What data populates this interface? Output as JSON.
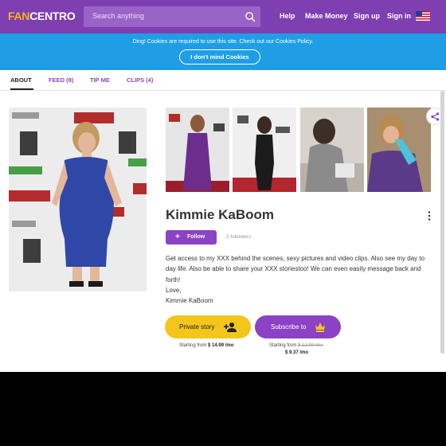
{
  "header": {
    "logo_fan": "FAN",
    "logo_centro": "CENTRO",
    "search_placeholder": "Search anything",
    "nav": [
      "Help",
      "Make Money",
      "Sign up",
      "Sign in"
    ],
    "colors": {
      "header_bg": "#7e3fb1",
      "accent": "#f7b21b"
    }
  },
  "cookie_banner": {
    "text": "Ding! Cookies are required to use this site. Check out our Cookies Policy.",
    "button": "I don't mind Cookies",
    "bg": "#1f9ee6"
  },
  "tabs": [
    {
      "label": "ABOUT",
      "active": true
    },
    {
      "label": "FEED (8)",
      "active": false
    },
    {
      "label": "TIP ME",
      "active": false
    },
    {
      "label": "CLIPS (4)",
      "active": false
    }
  ],
  "profile": {
    "name": "Kimmie KaBoom",
    "follow_label": "Follow",
    "followers": "2 followers",
    "bio": [
      "Get access to my  XXX behind the scenes, sexy pictures and video clips. Also see my day to day life. Also be able to share your XXX storiestoo! We can even easily message back and forth!",
      "Love,",
      "Kimmie KaBoom"
    ]
  },
  "cta": {
    "private": {
      "label": "Private story",
      "starting": "Starting from",
      "price": "$ 14.99 /mo"
    },
    "subscribe": {
      "label": "Subscribe to",
      "starting": "Starting from",
      "old_price": "$ 12.99 /mo",
      "price": "$ 9.37 /mo"
    }
  },
  "icons": [
    "search-icon",
    "flag-icon",
    "share-icon",
    "more-vertical-icon",
    "plus-icon",
    "add-user-icon",
    "crown-icon"
  ]
}
